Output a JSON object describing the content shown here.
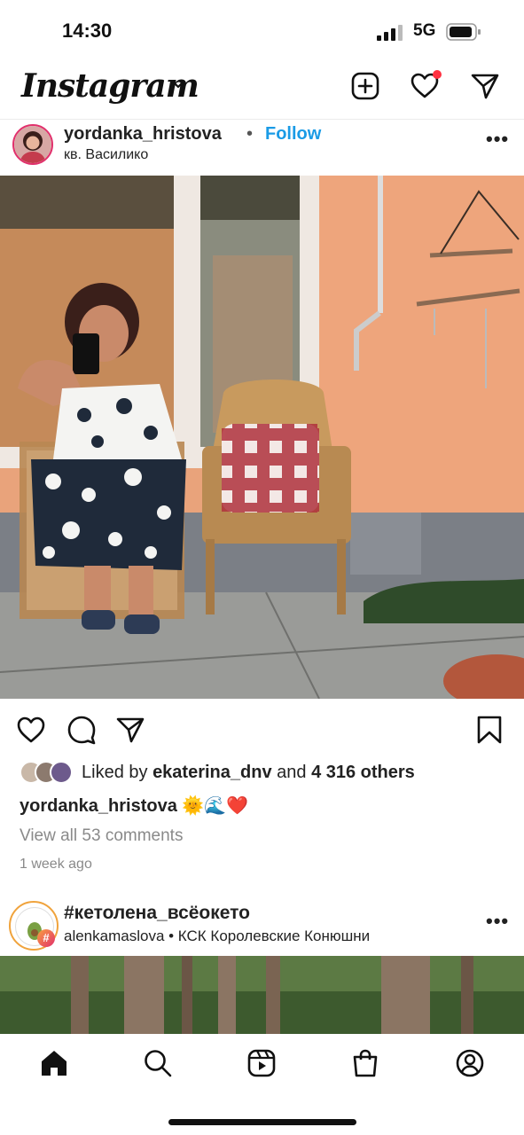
{
  "status_bar": {
    "time": "14:30",
    "network": "5G"
  },
  "header": {
    "logo": "Instagram"
  },
  "post": {
    "username": "yordanka_hristova",
    "separator": "•",
    "follow_label": "Follow",
    "location": "кв. Василико",
    "liked_prefix": "Liked by ",
    "liked_user": "ekaterina_dnv",
    "liked_and": " and ",
    "liked_others": "4 316 others",
    "caption_user": "yordanka_hristova",
    "caption_text": " 🌞🌊❤️",
    "view_comments": "View all 53 comments",
    "time_ago": "1 week ago"
  },
  "post2": {
    "title": "#кетолена_всёокето",
    "subtitle": "alenkamaslova • КСК Королевские Конюшни",
    "badge": "#"
  },
  "colors": {
    "follow": "#1a9be6",
    "notification": "#ff3040",
    "muted": "#8a8a8a"
  },
  "icons": [
    "signal-icon",
    "battery-icon",
    "chevron-down-icon",
    "new-post-icon",
    "heart-icon",
    "direct-icon",
    "more-icon",
    "like-icon",
    "comment-icon",
    "share-icon",
    "bookmark-icon",
    "home-icon",
    "search-icon",
    "reels-icon",
    "shop-icon",
    "profile-icon"
  ]
}
